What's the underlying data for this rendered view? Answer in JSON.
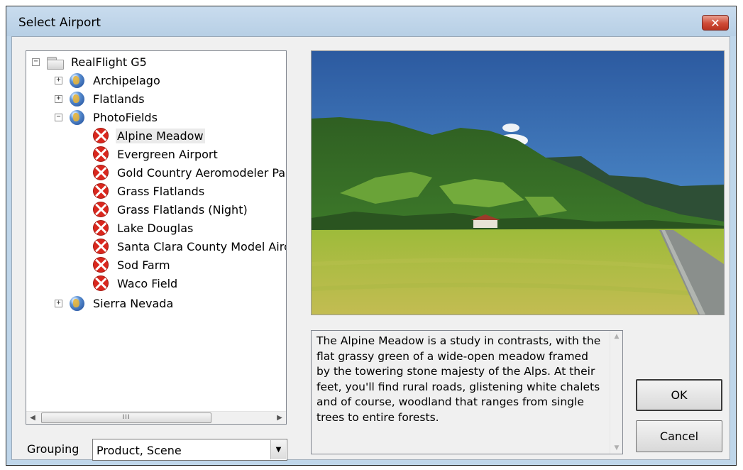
{
  "window": {
    "title": "Select Airport",
    "close_glyph": "✕"
  },
  "tree": {
    "root": {
      "label": "RealFlight G5",
      "expander": "−",
      "icon": "folder-icon"
    },
    "groups": [
      {
        "label": "Archipelago",
        "expander": "+",
        "icon": "globe-icon"
      },
      {
        "label": "Flatlands",
        "expander": "+",
        "icon": "globe-icon"
      },
      {
        "label": "PhotoFields",
        "expander": "−",
        "icon": "globe-icon"
      },
      {
        "label": "Sierra Nevada",
        "expander": "+",
        "icon": "globe-icon"
      }
    ],
    "airports": [
      {
        "label": "Alpine Meadow",
        "selected": true
      },
      {
        "label": "Evergreen Airport"
      },
      {
        "label": "Gold Country Aeromodeler Par"
      },
      {
        "label": "Grass Flatlands"
      },
      {
        "label": "Grass Flatlands (Night)"
      },
      {
        "label": "Lake Douglas"
      },
      {
        "label": "Santa Clara County Model Airc"
      },
      {
        "label": "Sod Farm"
      },
      {
        "label": "Waco Field"
      }
    ],
    "scrollbar": {
      "left_arrow": "◀",
      "right_arrow": "▶",
      "thumb_grip": "III"
    }
  },
  "grouping": {
    "label": "Grouping",
    "value": "Product, Scene",
    "dropdown_glyph": "▼"
  },
  "description": {
    "text": "The Alpine Meadow is a study in contrasts, with the flat grassy green of a wide-open meadow framed by the towering stone majesty of the Alps. At their feet, you'll find rural roads, glistening white chalets and of course, woodland that ranges from single trees to entire forests.",
    "scroll_up": "▲",
    "scroll_down": "▼"
  },
  "buttons": {
    "ok": "OK",
    "cancel": "Cancel"
  },
  "colors": {
    "title_bar": "#bfd6ea",
    "dialog_bg": "#f0f0f0",
    "close_button": "#cf4a36",
    "airport_icon": "#d9271e"
  }
}
